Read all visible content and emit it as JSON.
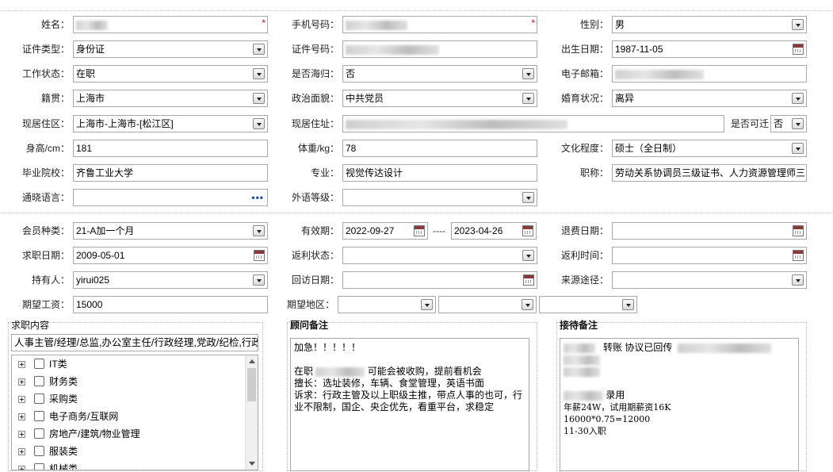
{
  "personal": {
    "name_label": "姓名：",
    "phone_label": "手机号码：",
    "gender_label": "性别：",
    "gender_value": "男",
    "idtype_label": "证件类型：",
    "idtype_value": "身份证",
    "idno_label": "证件号码：",
    "birth_label": "出生日期：",
    "birth_value": "1987-11-05",
    "workstatus_label": "工作状态：",
    "workstatus_value": "在职",
    "returnee_label": "是否海归：",
    "returnee_value": "否",
    "email_label": "电子邮箱：",
    "native_label": "籍贯：",
    "native_value": "上海市",
    "political_label": "政治面貌：",
    "political_value": "中共党员",
    "marital_label": "婚育状况：",
    "marital_value": "离异",
    "residence_label": "现居住区：",
    "residence_value": "上海市-上海市-[松江区]",
    "address_label": "现居住址：",
    "relocate_label": "是否可迁",
    "relocate_value": "否",
    "height_label": "身高/cm：",
    "height_value": "181",
    "weight_label": "体重/kg：",
    "weight_value": "78",
    "education_label": "文化程度：",
    "education_value": "硕士（全日制）",
    "school_label": "毕业院校：",
    "school_value": "齐鲁工业大学",
    "major_label": "专业：",
    "major_value": "视觉传达设计",
    "title_label": "职称：",
    "title_value": "劳动关系协调员三级证书、人力资源管理师三",
    "language_label": "通晓语言：",
    "language_more": "•••",
    "foreignlevel_label": "外语等级："
  },
  "membership": {
    "type_label": "会员种类：",
    "type_value": "21-A加一个月",
    "validity_label": "有效期：",
    "validity_start": "2022-09-27",
    "validity_sep": "----",
    "validity_end": "2023-04-26",
    "refund_label": "退费日期：",
    "jobdate_label": "求职日期：",
    "jobdate_value": "2009-05-01",
    "rebate_status_label": "返利状态：",
    "rebate_time_label": "返利时间：",
    "holder_label": "持有人：",
    "holder_value": "yirui025",
    "visit_label": "回访日期：",
    "source_label": "来源途径：",
    "salary_label": "期望工资：",
    "salary_value": "15000",
    "region_label": "期望地区："
  },
  "job_content": {
    "heading": "求职内容",
    "selected": "人事主管/经理/总监,办公室主任/行政经理,党政/纪检,行政主",
    "categories": [
      {
        "label": "IT类"
      },
      {
        "label": "财务类"
      },
      {
        "label": "采购类"
      },
      {
        "label": "电子商务/互联网"
      },
      {
        "label": "房地产/建筑/物业管理"
      },
      {
        "label": "服装类"
      },
      {
        "label": "机械类"
      }
    ]
  },
  "advisor_notes": {
    "heading": "顾问备注",
    "line1": "加急！！！！！",
    "line2a": "在职",
    "line2b": "可能会被收购，提前看机会",
    "line3": "擅长：选址装修，车辆、食堂管理，英语书面",
    "line4": "诉求：行政主管及以上职级主推，带点人事的也可，行",
    "line5": "业不限制，国企、央企优先，看重平台，求稳定"
  },
  "reception_notes": {
    "heading": "接待备注",
    "line1": "转账 协议已回传",
    "line2": "录用",
    "line3": "年薪24W，试用期薪资16K",
    "line4": "16000*0.75=12000",
    "line5": "11-30入职"
  },
  "colors": {
    "border": "#a9a9a9",
    "required": "#e00000",
    "dots": "#1a4fb0"
  }
}
